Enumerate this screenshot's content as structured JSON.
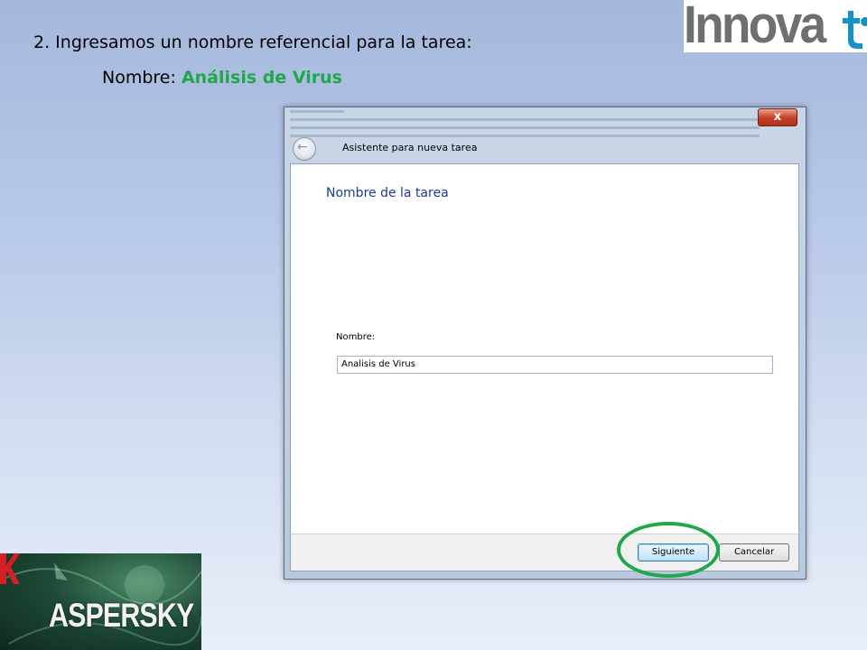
{
  "slide": {
    "step_text": "2. Ingresamos un nombre referencial para la tarea:",
    "name_prefix": "Nombre: ",
    "name_value": "Análisis de Virus"
  },
  "logo": {
    "text": "Innova"
  },
  "kaspersky": {
    "text": "ASPERSKY"
  },
  "window": {
    "title": "Asistente para nueva tarea",
    "close_symbol": "x",
    "back_symbol": "←",
    "heading": "Nombre de la tarea",
    "field_label": "Nombre:",
    "field_value": "Analisis de Virus",
    "next_label": "Siguiente",
    "cancel_label": "Cancelar"
  },
  "colors": {
    "accent_green": "#1fa74a",
    "heading_blue": "#1e3a8a",
    "logo_grey": "#6f6f6f",
    "logo_teal": "#1591c8"
  }
}
